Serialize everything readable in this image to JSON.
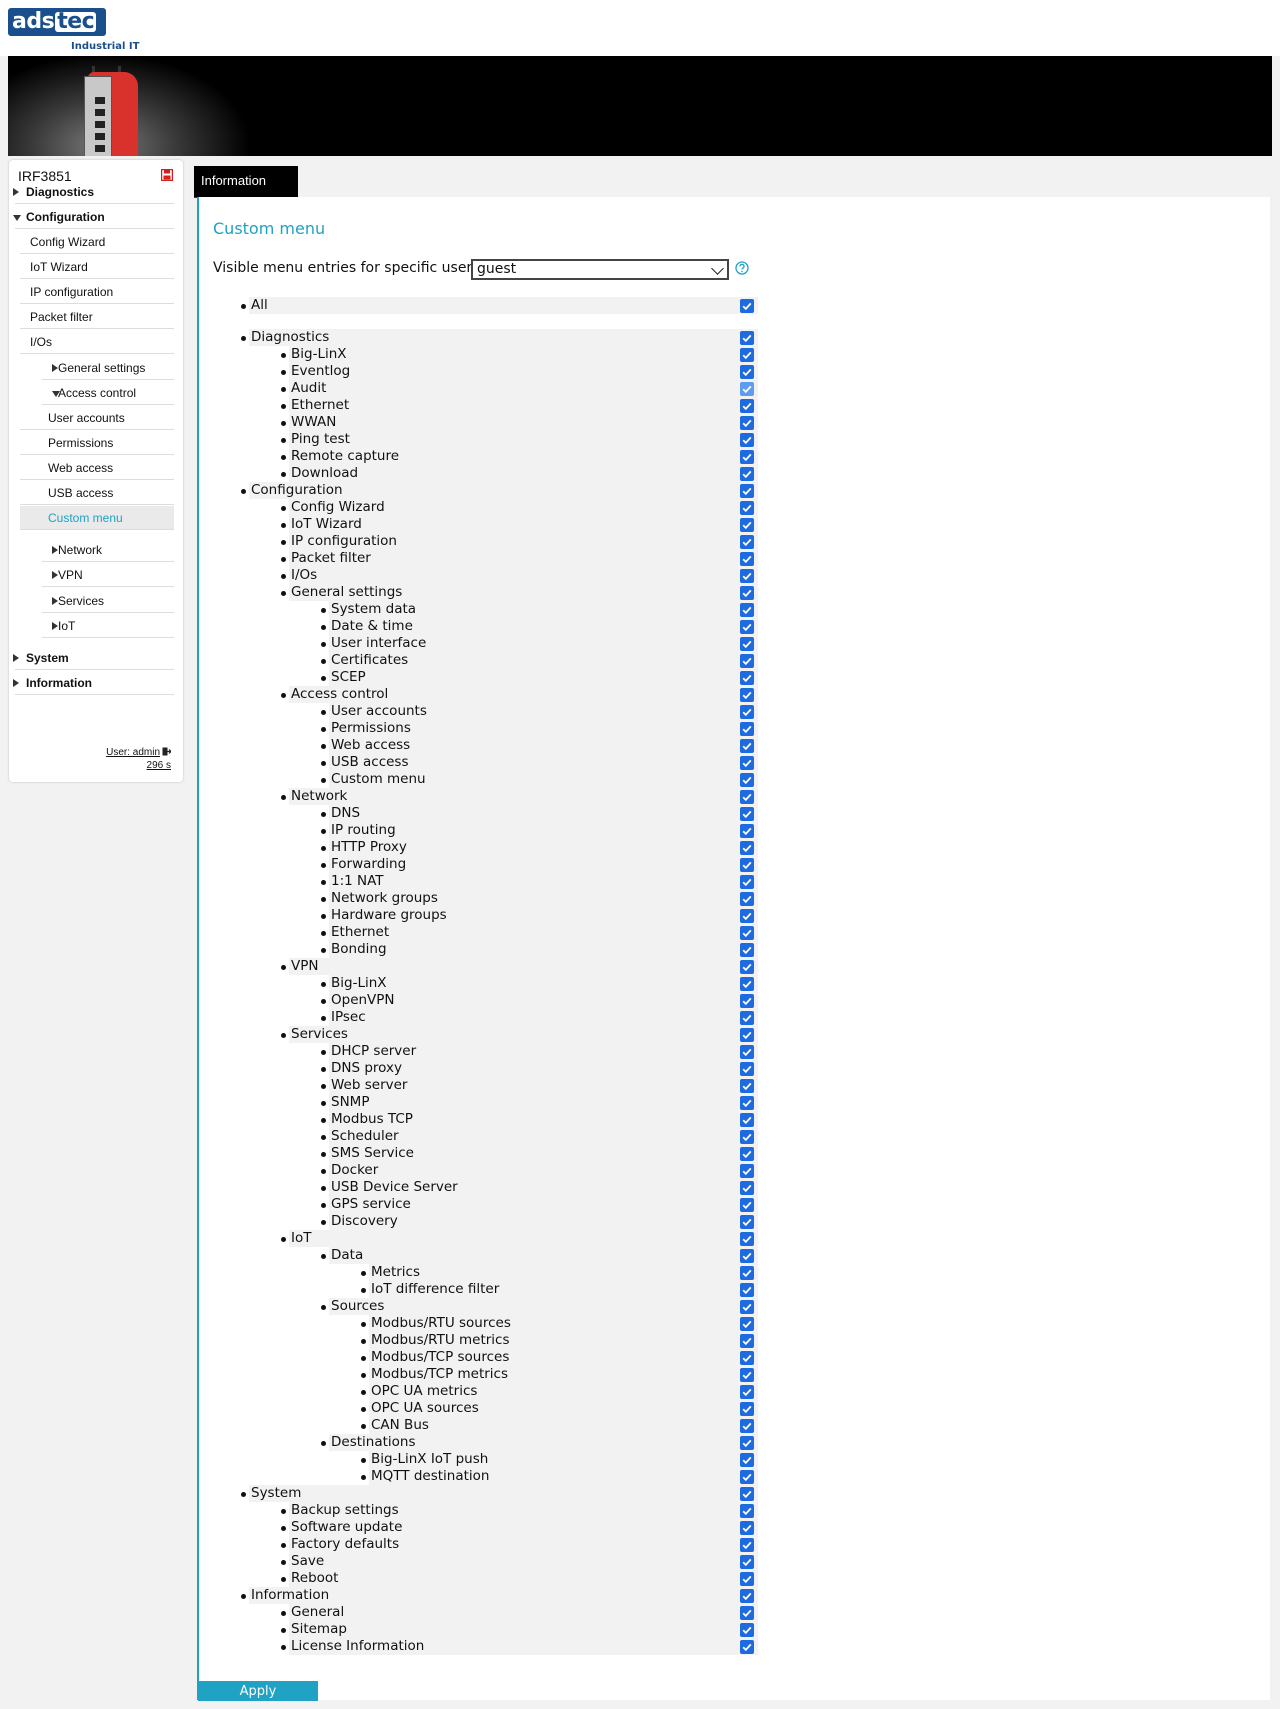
{
  "header": {
    "logo_main": "ads",
    "logo_accent": "tec",
    "tagline": "Industrial IT"
  },
  "sidebar": {
    "device_name": "IRF3851",
    "items": [
      {
        "label": "Diagnostics",
        "level": 0,
        "bold": true,
        "arrow": "right"
      },
      {
        "label": "Configuration",
        "level": 0,
        "bold": true,
        "arrow": "down"
      },
      {
        "label": "Config Wizard",
        "level": 1
      },
      {
        "label": "IoT Wizard",
        "level": 1
      },
      {
        "label": "IP configuration",
        "level": 1
      },
      {
        "label": "Packet filter",
        "level": 1
      },
      {
        "label": "I/Os",
        "level": 1
      },
      {
        "label": "General settings",
        "level": 2,
        "arrow": "right"
      },
      {
        "label": "Access control",
        "level": 2,
        "arrow": "down"
      },
      {
        "label": "User accounts",
        "level": 3
      },
      {
        "label": "Permissions",
        "level": 3
      },
      {
        "label": "Web access",
        "level": 3
      },
      {
        "label": "USB access",
        "level": 3
      },
      {
        "label": "Custom menu",
        "level": 3,
        "active": true
      },
      {
        "label": "Network",
        "level": 2,
        "arrow": "right"
      },
      {
        "label": "VPN",
        "level": 2,
        "arrow": "right"
      },
      {
        "label": "Services",
        "level": 2,
        "arrow": "right"
      },
      {
        "label": "IoT",
        "level": 2,
        "arrow": "right"
      },
      {
        "label": "System",
        "level": 0,
        "bold": true,
        "arrow": "right"
      },
      {
        "label": "Information",
        "level": 0,
        "bold": true,
        "arrow": "right"
      }
    ],
    "user_label": "User: admin",
    "session_timer": "296 s"
  },
  "tabs": [
    {
      "label": "Information",
      "active": true
    }
  ],
  "main": {
    "title": "Custom menu",
    "user_select_label": "Visible menu entries for specific users",
    "user_select_value": "guest",
    "apply_label": "Apply"
  },
  "colors": {
    "accent": "#1fa2c4",
    "checkbox": "#1e6be0",
    "brand": "#1a4f8c"
  },
  "menu_entries": [
    {
      "label": "All",
      "level": 0,
      "checked": true
    },
    {
      "label": "Diagnostics",
      "level": 0,
      "checked": true
    },
    {
      "label": "Big-LinX",
      "level": 1,
      "checked": true
    },
    {
      "label": "Eventlog",
      "level": 1,
      "checked": true
    },
    {
      "label": "Audit",
      "level": 1,
      "checked": true,
      "disabled": true
    },
    {
      "label": "Ethernet",
      "level": 1,
      "checked": true
    },
    {
      "label": "WWAN",
      "level": 1,
      "checked": true
    },
    {
      "label": "Ping test",
      "level": 1,
      "checked": true
    },
    {
      "label": "Remote capture",
      "level": 1,
      "checked": true
    },
    {
      "label": "Download",
      "level": 1,
      "checked": true
    },
    {
      "label": "Configuration",
      "level": 0,
      "checked": true
    },
    {
      "label": "Config Wizard",
      "level": 1,
      "checked": true
    },
    {
      "label": "IoT Wizard",
      "level": 1,
      "checked": true
    },
    {
      "label": "IP configuration",
      "level": 1,
      "checked": true
    },
    {
      "label": "Packet filter",
      "level": 1,
      "checked": true
    },
    {
      "label": "I/Os",
      "level": 1,
      "checked": true
    },
    {
      "label": "General settings",
      "level": 1,
      "checked": true
    },
    {
      "label": "System data",
      "level": 2,
      "checked": true
    },
    {
      "label": "Date & time",
      "level": 2,
      "checked": true
    },
    {
      "label": "User interface",
      "level": 2,
      "checked": true
    },
    {
      "label": "Certificates",
      "level": 2,
      "checked": true
    },
    {
      "label": "SCEP",
      "level": 2,
      "checked": true
    },
    {
      "label": "Access control",
      "level": 1,
      "checked": true
    },
    {
      "label": "User accounts",
      "level": 2,
      "checked": true
    },
    {
      "label": "Permissions",
      "level": 2,
      "checked": true
    },
    {
      "label": "Web access",
      "level": 2,
      "checked": true
    },
    {
      "label": "USB access",
      "level": 2,
      "checked": true
    },
    {
      "label": "Custom menu",
      "level": 2,
      "checked": true
    },
    {
      "label": "Network",
      "level": 1,
      "checked": true
    },
    {
      "label": "DNS",
      "level": 2,
      "checked": true
    },
    {
      "label": "IP routing",
      "level": 2,
      "checked": true
    },
    {
      "label": "HTTP Proxy",
      "level": 2,
      "checked": true
    },
    {
      "label": "Forwarding",
      "level": 2,
      "checked": true
    },
    {
      "label": "1:1 NAT",
      "level": 2,
      "checked": true
    },
    {
      "label": "Network groups",
      "level": 2,
      "checked": true
    },
    {
      "label": "Hardware groups",
      "level": 2,
      "checked": true
    },
    {
      "label": "Ethernet",
      "level": 2,
      "checked": true
    },
    {
      "label": "Bonding",
      "level": 2,
      "checked": true
    },
    {
      "label": "VPN",
      "level": 1,
      "checked": true
    },
    {
      "label": "Big-LinX",
      "level": 2,
      "checked": true
    },
    {
      "label": "OpenVPN",
      "level": 2,
      "checked": true
    },
    {
      "label": "IPsec",
      "level": 2,
      "checked": true
    },
    {
      "label": "Services",
      "level": 1,
      "checked": true
    },
    {
      "label": "DHCP server",
      "level": 2,
      "checked": true
    },
    {
      "label": "DNS proxy",
      "level": 2,
      "checked": true
    },
    {
      "label": "Web server",
      "level": 2,
      "checked": true
    },
    {
      "label": "SNMP",
      "level": 2,
      "checked": true
    },
    {
      "label": "Modbus TCP",
      "level": 2,
      "checked": true
    },
    {
      "label": "Scheduler",
      "level": 2,
      "checked": true
    },
    {
      "label": "SMS Service",
      "level": 2,
      "checked": true
    },
    {
      "label": "Docker",
      "level": 2,
      "checked": true
    },
    {
      "label": "USB Device Server",
      "level": 2,
      "checked": true
    },
    {
      "label": "GPS service",
      "level": 2,
      "checked": true
    },
    {
      "label": "Discovery",
      "level": 2,
      "checked": true
    },
    {
      "label": "IoT",
      "level": 1,
      "checked": true
    },
    {
      "label": "Data",
      "level": 2,
      "checked": true
    },
    {
      "label": "Metrics",
      "level": 3,
      "checked": true
    },
    {
      "label": "IoT difference filter",
      "level": 3,
      "checked": true
    },
    {
      "label": "Sources",
      "level": 2,
      "checked": true
    },
    {
      "label": "Modbus/RTU sources",
      "level": 3,
      "checked": true
    },
    {
      "label": "Modbus/RTU metrics",
      "level": 3,
      "checked": true
    },
    {
      "label": "Modbus/TCP sources",
      "level": 3,
      "checked": true
    },
    {
      "label": "Modbus/TCP metrics",
      "level": 3,
      "checked": true
    },
    {
      "label": "OPC UA metrics",
      "level": 3,
      "checked": true
    },
    {
      "label": "OPC UA sources",
      "level": 3,
      "checked": true
    },
    {
      "label": "CAN Bus",
      "level": 3,
      "checked": true
    },
    {
      "label": "Destinations",
      "level": 2,
      "checked": true
    },
    {
      "label": "Big-LinX IoT push",
      "level": 3,
      "checked": true
    },
    {
      "label": "MQTT destination",
      "level": 3,
      "checked": true
    },
    {
      "label": "System",
      "level": 0,
      "checked": true
    },
    {
      "label": "Backup settings",
      "level": 1,
      "checked": true
    },
    {
      "label": "Software update",
      "level": 1,
      "checked": true
    },
    {
      "label": "Factory defaults",
      "level": 1,
      "checked": true
    },
    {
      "label": "Save",
      "level": 1,
      "checked": true
    },
    {
      "label": "Reboot",
      "level": 1,
      "checked": true
    },
    {
      "label": "Information",
      "level": 0,
      "checked": true
    },
    {
      "label": "General",
      "level": 1,
      "checked": true
    },
    {
      "label": "Sitemap",
      "level": 1,
      "checked": true
    },
    {
      "label": "License Information",
      "level": 1,
      "checked": true
    }
  ]
}
